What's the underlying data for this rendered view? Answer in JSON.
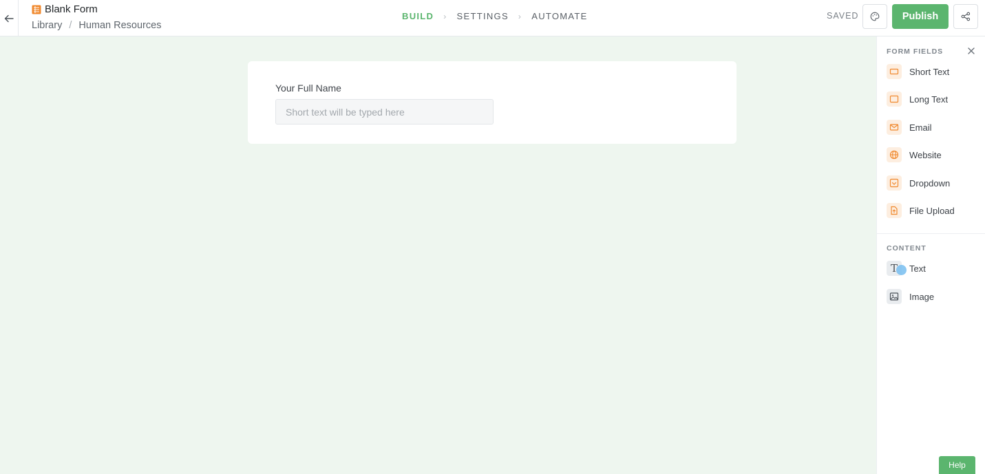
{
  "header": {
    "title": "Blank Form",
    "breadcrumb": [
      "Library",
      "Human Resources"
    ],
    "breadcrumb_separator": "/",
    "steps": [
      {
        "label": "BUILD",
        "active": true
      },
      {
        "label": "SETTINGS",
        "active": false
      },
      {
        "label": "AUTOMATE",
        "active": false
      }
    ],
    "status": "SAVED",
    "publish_label": "Publish",
    "icons": {
      "back": "arrow-left-icon",
      "form": "form-grid-icon",
      "theme": "palette-icon",
      "share": "share-icon",
      "step_separator": "chevron-right-icon"
    }
  },
  "form": {
    "fields": [
      {
        "label": "Your Full Name",
        "placeholder": "Short text will be typed here"
      }
    ]
  },
  "panel": {
    "form_fields_title": "FORM FIELDS",
    "form_fields": [
      {
        "label": "Short Text",
        "icon": "short-text-icon"
      },
      {
        "label": "Long Text",
        "icon": "long-text-icon"
      },
      {
        "label": "Email",
        "icon": "email-icon"
      },
      {
        "label": "Website",
        "icon": "globe-icon"
      },
      {
        "label": "Dropdown",
        "icon": "dropdown-icon"
      },
      {
        "label": "File Upload",
        "icon": "file-upload-icon"
      }
    ],
    "content_title": "CONTENT",
    "content": [
      {
        "label": "Text",
        "icon": "text-icon"
      },
      {
        "label": "Image",
        "icon": "image-icon"
      }
    ]
  },
  "help_label": "Help",
  "colors": {
    "accent": "#5bb56e",
    "canvas": "#eef6ef",
    "field_icon": "#f0892e"
  }
}
